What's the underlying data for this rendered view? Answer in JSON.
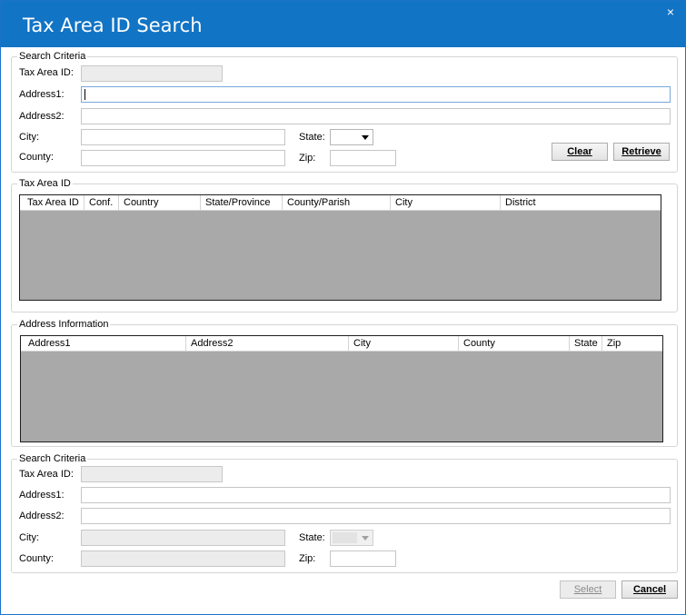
{
  "window": {
    "title": "Tax Area ID Search",
    "close_icon": "×"
  },
  "search_top": {
    "legend": "Search Criteria",
    "tax_area_id_label": "Tax Area ID:",
    "address1_label": "Address1:",
    "address2_label": "Address2:",
    "city_label": "City:",
    "county_label": "County:",
    "state_label": "State:",
    "zip_label": "Zip:",
    "tax_area_id_value": "",
    "address1_value": "",
    "address2_value": "",
    "city_value": "",
    "county_value": "",
    "state_value": "",
    "zip_value": "",
    "clear_button": "Clear",
    "retrieve_button": "Retrieve"
  },
  "tax_area_grid": {
    "legend": "Tax Area ID",
    "columns": [
      "Tax Area ID",
      "Conf.",
      "Country",
      "State/Province",
      "County/Parish",
      "City",
      "District"
    ]
  },
  "address_grid": {
    "legend": "Address Information",
    "columns": [
      "Address1",
      "Address2",
      "City",
      "County",
      "State",
      "Zip"
    ]
  },
  "search_bottom": {
    "legend": "Search Criteria",
    "tax_area_id_label": "Tax Area ID:",
    "address1_label": "Address1:",
    "address2_label": "Address2:",
    "city_label": "City:",
    "county_label": "County:",
    "state_label": "State:",
    "zip_label": "Zip:"
  },
  "footer": {
    "select_button": "Select",
    "cancel_button": "Cancel"
  },
  "colors": {
    "title_bar": "#1274c5",
    "grid_body": "#a9a9a9"
  }
}
